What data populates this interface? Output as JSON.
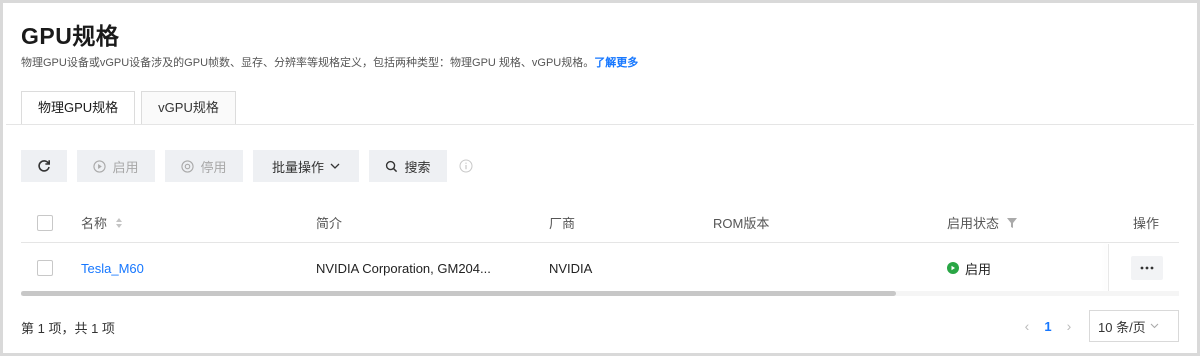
{
  "header": {
    "title": "GPU规格",
    "description": "物理GPU设备或vGPU设备涉及的GPU帧数、显存、分辨率等规格定义，包括两种类型：物理GPU 规格、vGPU规格。",
    "learn_more": "了解更多"
  },
  "tabs": [
    {
      "label": "物理GPU规格",
      "active": true
    },
    {
      "label": "vGPU规格",
      "active": false
    }
  ],
  "toolbar": {
    "refresh_icon": "refresh-icon",
    "enable_label": "启用",
    "disable_label": "停用",
    "batch_label": "批量操作",
    "search_label": "搜索"
  },
  "table": {
    "columns": [
      "名称",
      "简介",
      "厂商",
      "ROM版本",
      "启用状态",
      "操作"
    ],
    "rows": [
      {
        "name": "Tesla_M60",
        "description": "NVIDIA Corporation, GM204...",
        "vendor": "NVIDIA",
        "rom_version": "",
        "status": "启用"
      }
    ]
  },
  "footer": {
    "summary": "第 1 项，共 1 项",
    "current_page": "1",
    "page_size": "10 条/页"
  },
  "colors": {
    "link": "#1677ff",
    "status_enabled": "#29a645",
    "toolbar_bg": "#eef0f3"
  }
}
